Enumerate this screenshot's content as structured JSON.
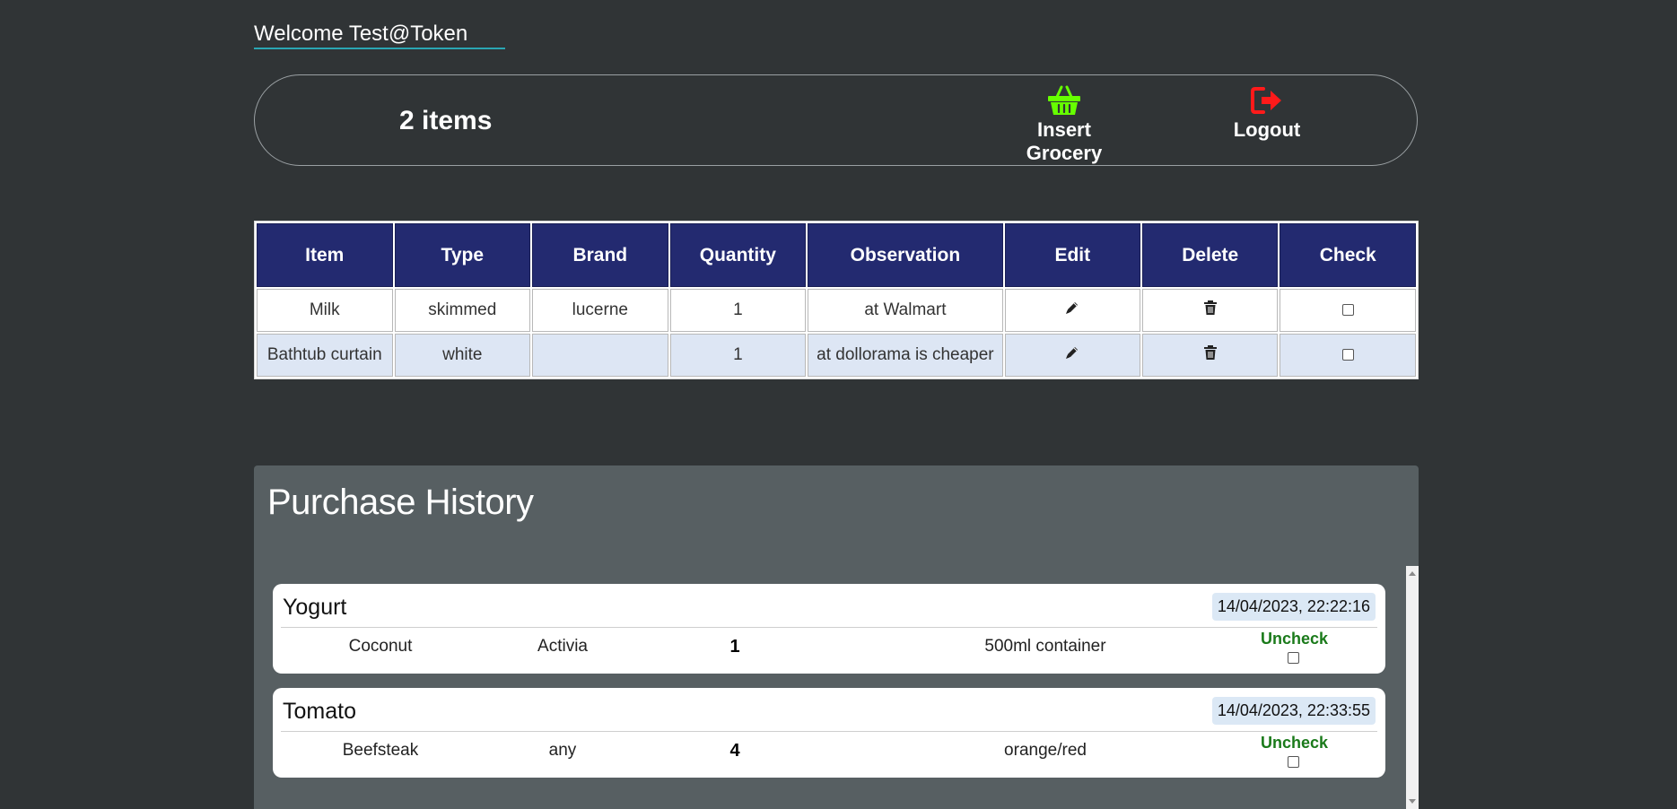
{
  "welcome": "Welcome Test@Token",
  "topbar": {
    "count": "2 items",
    "insert_label": "Insert Grocery",
    "logout_label": "Logout",
    "insert_icon": "basket-icon",
    "logout_icon": "logout-icon",
    "insert_color": "#66ff00",
    "logout_color": "#ff1a1a"
  },
  "table": {
    "headers": [
      "Item",
      "Type",
      "Brand",
      "Quantity",
      "Observation",
      "Edit",
      "Delete",
      "Check"
    ],
    "rows": [
      {
        "item": "Milk",
        "type": "skimmed",
        "brand": "lucerne",
        "quantity": "1",
        "observation": "at Walmart"
      },
      {
        "item": "Bathtub curtain",
        "type": "white",
        "brand": "",
        "quantity": "1",
        "observation": "at dollorama is cheaper"
      }
    ],
    "header_color": "#232a70",
    "alt_row_color": "#dde6f4"
  },
  "history": {
    "title": "Purchase History",
    "cards": [
      {
        "name": "Yogurt",
        "date": "14/04/2023, 22:22:16",
        "type": "Coconut",
        "brand": "Activia",
        "quantity": "1",
        "observation": "500ml container",
        "action": "Uncheck"
      },
      {
        "name": "Tomato",
        "date": "14/04/2023, 22:33:55",
        "type": "Beefsteak",
        "brand": "any",
        "quantity": "4",
        "observation": "orange/red",
        "action": "Uncheck"
      }
    ]
  }
}
